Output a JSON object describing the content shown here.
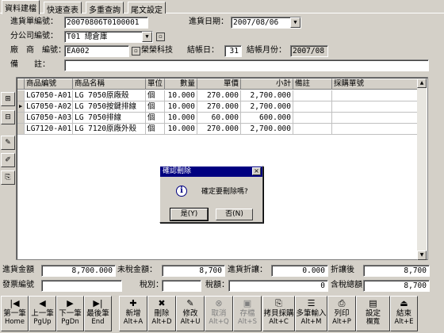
{
  "tabs": [
    "資料建檔",
    "快速查表",
    "多重查詢",
    "尾文設定"
  ],
  "header": {
    "order_no_label": "進貨單編號：",
    "order_no": "20070806T0100001",
    "date_label": "進貨日期：",
    "date": "2007/08/06",
    "branch_label": "分公司編號：",
    "branch": "T01 總倉庫",
    "vendor_label": "廠　商　編號：",
    "vendor_code": "EA002",
    "vendor_name": "榮榮科技",
    "close_day_label": "結帳日：",
    "close_day": "31",
    "close_month_label": "結帳月份：",
    "close_month": "2007/08",
    "note_label": "備　　註：",
    "note": ""
  },
  "grid": {
    "columns": [
      "商品編號",
      "商品名稱",
      "單位",
      "數量",
      "單價",
      "小計",
      "備註",
      "採購單號"
    ],
    "rows": [
      [
        "LG7050-A01",
        "LG 7050原廠殼",
        "個",
        "10.000",
        "270.000",
        "2,700.000",
        "",
        ""
      ],
      [
        "LG7050-A02",
        "LG 7050按鍵排線",
        "個",
        "10.000",
        "270.000",
        "2,700.000",
        "",
        ""
      ],
      [
        "LG7050-A03",
        "LG 7050排線",
        "個",
        "10.000",
        "60.000",
        "600.000",
        "",
        ""
      ],
      [
        "LG7120-A01",
        "LG 7120原廠外殼",
        "個",
        "10.000",
        "270.000",
        "2,700.000",
        "",
        ""
      ]
    ]
  },
  "dialog": {
    "title": "確認刪除",
    "message": "確定要刪除嗎?",
    "yes": "是(Y)",
    "no": "否(N)",
    "info_glyph": "i",
    "close_glyph": "×"
  },
  "footer": {
    "amount_label": "進貨金額",
    "amount": "8,700.000",
    "pretax_label": "未稅金額：",
    "pretax": "8,700",
    "discount_label": "進貨折讓：",
    "discount": "0.000",
    "after_discount_label": "折讓後",
    "after_discount": "8,700",
    "invoice_label": "發票編號",
    "invoice": "",
    "tax_type_label": "稅別：",
    "tax_type": "",
    "tax_label": "稅額：",
    "tax": "0",
    "total_label": "含稅總額",
    "total": "8,700"
  },
  "toolbar": [
    {
      "label": "第一筆",
      "key": "Home",
      "icon": "|◀",
      "enabled": true
    },
    {
      "label": "上一筆",
      "key": "PgUp",
      "icon": "◀",
      "enabled": true
    },
    {
      "label": "下一筆",
      "key": "PgDn",
      "icon": "▶",
      "enabled": true
    },
    {
      "label": "最後筆",
      "key": "End",
      "icon": "▶|",
      "enabled": true
    },
    {
      "label": "新增",
      "key": "Alt+A",
      "icon": "✚",
      "enabled": true
    },
    {
      "label": "刪除",
      "key": "Alt+D",
      "icon": "✖",
      "enabled": true
    },
    {
      "label": "修改",
      "key": "Alt+U",
      "icon": "✎",
      "enabled": true
    },
    {
      "label": "取消",
      "key": "Alt+Q",
      "icon": "⊗",
      "enabled": false
    },
    {
      "label": "存檔",
      "key": "Alt+S",
      "icon": "▣",
      "enabled": false
    },
    {
      "label": "拷貝採購",
      "key": "Alt+C",
      "icon": "⎘",
      "enabled": true
    },
    {
      "label": "多筆輸入",
      "key": "Alt+M",
      "icon": "☰",
      "enabled": true
    },
    {
      "label": "列印",
      "key": "Alt+P",
      "icon": "⎙",
      "enabled": true
    },
    {
      "label": "設定",
      "key": "欄寬",
      "icon": "▤",
      "enabled": true
    },
    {
      "label": "結束",
      "key": "Alt+E",
      "icon": "⏏",
      "enabled": true
    }
  ],
  "colors": {
    "window_bg": "#d4d0c8",
    "title_bar": "#000080",
    "field_bg": "#ffffff"
  }
}
